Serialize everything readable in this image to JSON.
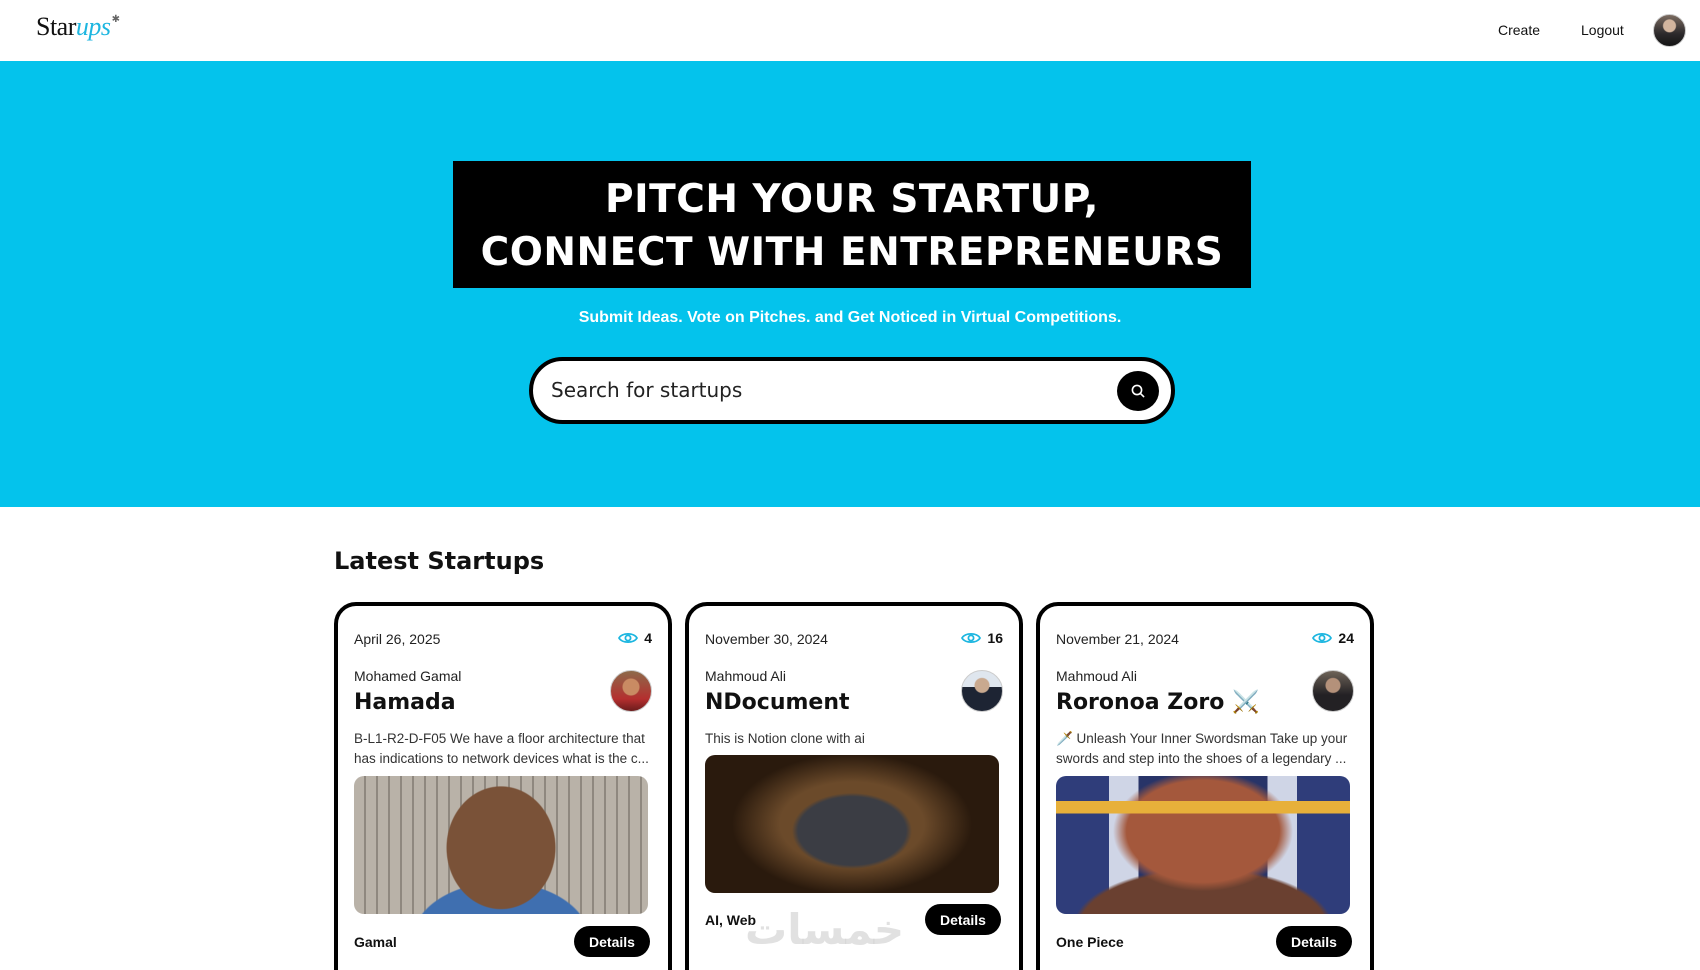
{
  "navbar": {
    "logo_text_main": "Star",
    "logo_text_accent": "ups",
    "create_label": "Create",
    "logout_label": "Logout"
  },
  "hero": {
    "title_line1": "PITCH YOUR STARTUP,",
    "title_line2": "CONNECT WITH ENTREPRENEURS",
    "subtitle": "Submit Ideas. Vote on Pitches. and Get Noticed in Virtual Competitions.",
    "search_placeholder": "Search for startups"
  },
  "section": {
    "title": "Latest Startups"
  },
  "cards": [
    {
      "date": "April 26, 2025",
      "views": "4",
      "author": "Mohamed Gamal",
      "title": "Hamada",
      "description": "B-L1-R2-D-F05 We have a floor architecture that has indications to network devices what is the c...",
      "category": "Gamal",
      "button_label": "Details"
    },
    {
      "date": "November 30, 2024",
      "views": "16",
      "author": "Mahmoud Ali",
      "title": "NDocument",
      "description": "This is Notion clone with ai",
      "category": "AI, Web",
      "button_label": "Details"
    },
    {
      "date": "November 21, 2024",
      "views": "24",
      "author": "Mahmoud Ali",
      "title": "Roronoa Zoro ⚔️",
      "description": "🗡️ Unleash Your Inner Swordsman Take up your swords and step into the shoes of a legendary ...",
      "category": "One Piece",
      "button_label": "Details"
    }
  ],
  "watermark": "خمسات",
  "colors": {
    "hero_bg": "#04c3ec",
    "accent": "#1db6e0",
    "dark": "#000000"
  },
  "icons": {
    "search": "search-icon",
    "views": "eye-icon"
  }
}
